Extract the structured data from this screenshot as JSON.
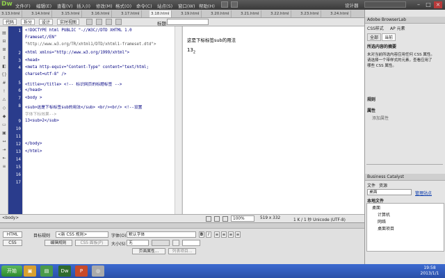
{
  "app": {
    "logo": "Dw",
    "menu": [
      "文件(F)",
      "编辑(E)",
      "查看(V)",
      "插入(I)",
      "修改(M)",
      "格式(O)",
      "命令(C)",
      "站点(S)",
      "窗口(W)",
      "帮助(H)"
    ],
    "workspace": "设计器"
  },
  "tabs": [
    "3.13.html",
    "3.14.html",
    "3.15.html",
    "3.16.html",
    "3.17.html",
    "3.18.html",
    "3.19.html",
    "3.20.html",
    "3.21.html",
    "3.22.html",
    "3.23.html",
    "3.24.html"
  ],
  "active_tab": "3.18.html",
  "toolbar": {
    "code": "代码",
    "split": "拆分",
    "design": "设计",
    "live": "实时视图",
    "title_label": "标题:"
  },
  "code_lines": [
    "<!DOCTYPE html PUBLIC \"-//W3C//DTD XHTML 1.0",
    "Frameset//EN\"",
    "\"http://www.w3.org/TR/xhtml1/DTD/xhtml1-frameset.dtd\">",
    "<html xmlns=\"http://www.w3.org/1999/xhtml\">",
    "<head>",
    "<meta http-equiv=\"Content-Type\" content=\"text/html;",
    "charset=utf-8\" />",
    "<title></title>        <!-- 标识网页的标题标签 -->",
    "</head>",
    "<body >",
    "<sub>这是下标标签sub的用法</sub> <br/><br/>     <!--设置",
    "字体下标效果-->",
    "13<sub>2</sub>",
    "",
    "",
    "</body>",
    "</html>",
    ""
  ],
  "line_numbers": [
    "1",
    "",
    "",
    "2",
    "3",
    "4",
    "",
    "5",
    "6",
    "7",
    "8",
    "",
    "9",
    "10",
    "11",
    "12",
    "13",
    "14",
    "15",
    "16",
    "17"
  ],
  "design": {
    "text": "这是下标标签sub的用法",
    "num": "13",
    "sub": "2"
  },
  "status": {
    "tag": "<body>",
    "zoom": "100%",
    "size": "519 x 332",
    "info": "1 K / 1 秒  Unicode (UTF-8)"
  },
  "props": {
    "html": "HTML",
    "css": "CSS",
    "target_rule_label": "目标规则",
    "target_rule": "<新 CSS 规则>",
    "edit_rule": "编辑规则",
    "css_panel": "CSS 面板(P)",
    "font_label": "字体(O)",
    "font_value": "默认字体",
    "size_label": "大小(S)",
    "size_value": "无",
    "page_props": "页面属性...",
    "list_item": "列表项目..."
  },
  "right": {
    "header1": "Adobe BrowserLab",
    "css_tab": "CSS样式",
    "ap_tab": "AP 元素",
    "all": "全部",
    "current": "当前",
    "summary_title": "所选内容的摘要",
    "summary_text": [
      "未对当前所选内容应用任何 CSS 属性。",
      "请选择一个带样式的元素，查看应用了",
      "哪些 CSS 属性。"
    ],
    "rules": "规则",
    "properties": "属性",
    "add_property": "添加属性",
    "bc": "Business Catalyst",
    "files_tab": "文件",
    "assets_tab": "资源",
    "location": "桌面",
    "manage": "管理站点",
    "local_files": "本地文件",
    "tree": [
      "桌面",
      "计算机",
      "网络",
      "桌面项目"
    ]
  },
  "taskbar": {
    "start": "开始",
    "time": "19:58",
    "date": "2013/1/1"
  },
  "colors": {
    "titlebar": "#3a3a3a",
    "code_bg": "#ffffff",
    "left_gutter": "#2a3c8c",
    "taskbar": "#2a4fa8"
  }
}
